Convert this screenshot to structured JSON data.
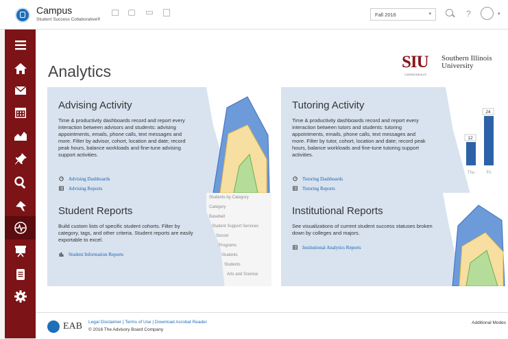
{
  "header": {
    "title": "Campus",
    "subtitle": "Student Success Collaborative®",
    "term_select": "Fall 2016",
    "help": "?"
  },
  "sidebar": {
    "items": [
      {
        "name": "menu"
      },
      {
        "name": "home"
      },
      {
        "name": "mail"
      },
      {
        "name": "calendar"
      },
      {
        "name": "trend"
      },
      {
        "name": "pin"
      },
      {
        "name": "search"
      },
      {
        "name": "flag"
      },
      {
        "name": "pulse"
      },
      {
        "name": "presentation"
      },
      {
        "name": "document"
      },
      {
        "name": "gear"
      }
    ]
  },
  "page": {
    "title": "Analytics",
    "university_mark": "SIU",
    "university_campus": "CARBONDALE",
    "university_name_1": "Southern Illinois",
    "university_name_2": "University"
  },
  "cards": {
    "advising": {
      "title": "Advising Activity",
      "desc": "Time & productivity dashboards record and report every interaction between advisors and students: advising appointments, emails, phone calls, text messages and more. Filter by advisor, cohort, location and date; record peak hours, balance workloads and fine-tune advising support activities.",
      "link1": "Advising Dashboards",
      "link2": "Advising Reports"
    },
    "tutoring": {
      "title": "Tutoring Activity",
      "desc": "Time & productivity dashboards record and report every interaction between tutors and students: tutoring appointments, emails, phone calls, text messages and more. Filter by tutor, cohort, location and date; record peak hours, balance workloads and fine-tune tutoring support activities.",
      "link1": "Tutoring Dashboards",
      "link2": "Tutoring Reports",
      "bar_labels": [
        "12",
        "24"
      ],
      "axis_labels": [
        "Thu",
        "Fri"
      ]
    },
    "student": {
      "title": "Student Reports",
      "desc": "Build custom lists of specific student cohorts. Filter by category, tags, and other criteria. Student reports are easily exportable to excel.",
      "link1": "Student Information Reports",
      "list": [
        "Students by Category",
        "Category",
        "Baseball",
        "Student Support Services",
        "Soccer",
        "Programs",
        "Students",
        "Students",
        "Arts and Science"
      ]
    },
    "institutional": {
      "title": "Institutional Reports",
      "desc": "See visualizations of current student success statuses broken down by colleges and majors.",
      "link1": "Institutional Analytics Reports"
    }
  },
  "footer": {
    "brand": "EAB",
    "link1": "Legal Disclaimer",
    "link2": "Terms of Use",
    "link3": "Download Acrobat Reader",
    "sep": "|",
    "copyright": "© 2016 The Advisory Board Company",
    "right": "Additional Modes"
  },
  "colors": {
    "sidebar": "#7c1317",
    "card": "#d8e3ef",
    "link": "#1d5ea8",
    "bar": "#2d62a8"
  }
}
